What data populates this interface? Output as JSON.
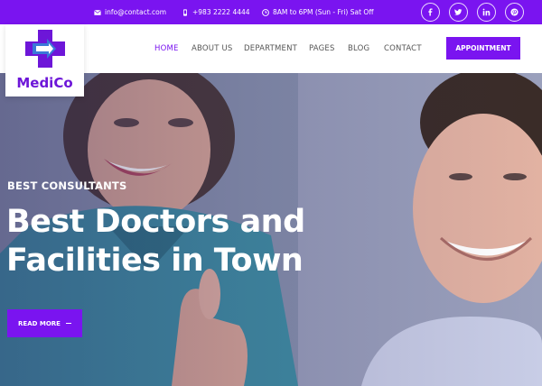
{
  "topbar": {
    "email": "info@contact.com",
    "phone": "+983 2222 4444",
    "hours": "8AM to 6PM (Sun - Fri) Sat Off",
    "icons": [
      "envelope-icon",
      "phone-icon",
      "clock-icon"
    ],
    "social": [
      "facebook-icon",
      "twitter-icon",
      "linkedin-icon",
      "pinterest-icon"
    ]
  },
  "brand": {
    "name": "MediCo"
  },
  "nav": {
    "items": [
      "HOME",
      "ABOUT US",
      "DEPARTMENT",
      "PAGES",
      "BLOG",
      "CONTACT"
    ],
    "active": "HOME",
    "cta": "APPOINTMENT"
  },
  "hero": {
    "kicker": "BEST CONSULTANTS",
    "headline_line1": "Best Doctors and",
    "headline_line2": "Facilities in Town",
    "button": "READ MORE"
  },
  "colors": {
    "accent": "#7a14f0",
    "nav_text": "#555555",
    "white": "#ffffff"
  }
}
